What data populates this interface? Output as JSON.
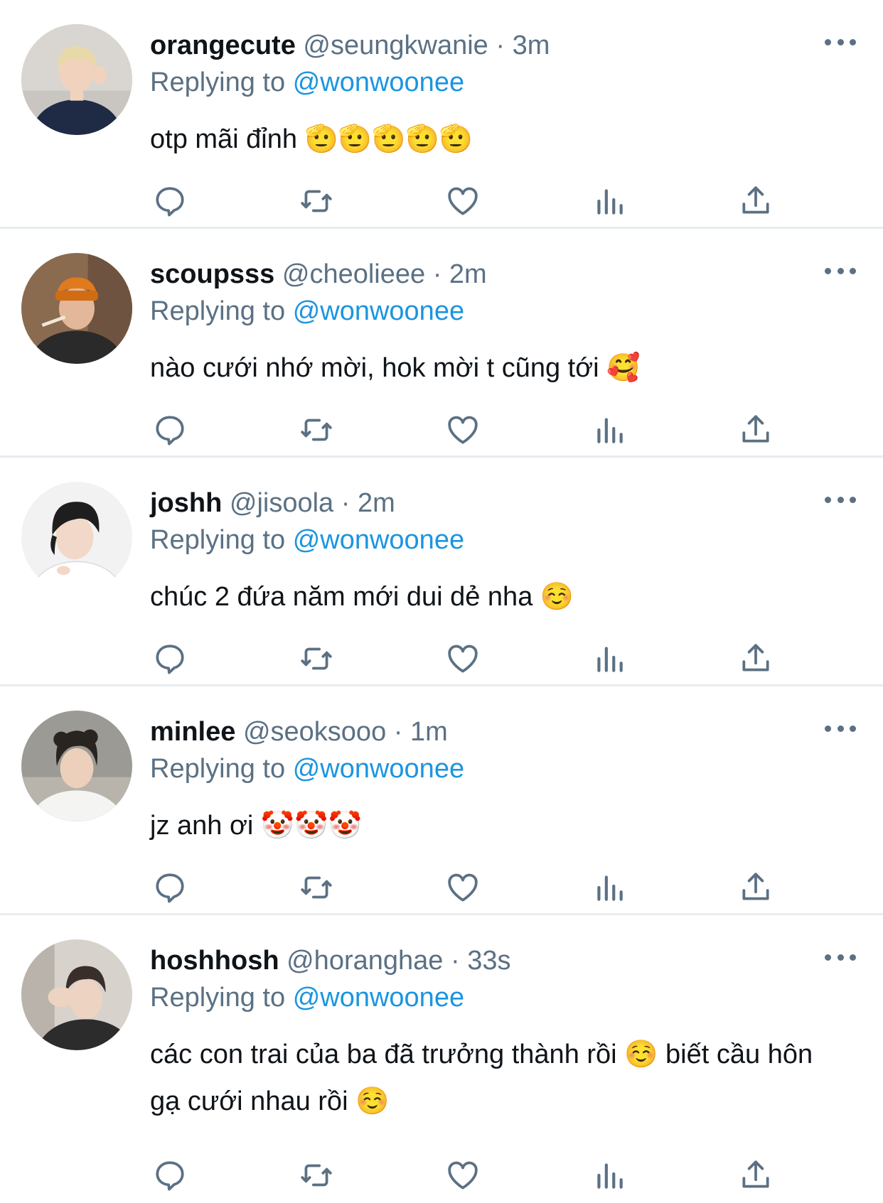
{
  "tweets": [
    {
      "name": "orangecute",
      "handle": "@seungkwanie",
      "separator": "·",
      "time": "3m",
      "replying_prefix": "Replying to",
      "replying_to": "@wonwoonee",
      "text": "otp mãi đỉnh 🫡🫡🫡🫡🫡",
      "avatar_colors": {
        "bg": "#c9c6c2",
        "hair": "#e8d9a8",
        "skin": "#f0d2bd",
        "shirt": "#1f2a44"
      }
    },
    {
      "name": "scoupsss",
      "handle": "@cheolieee",
      "separator": "·",
      "time": "2m",
      "replying_prefix": "Replying to",
      "replying_to": "@wonwoonee",
      "text": "nào cưới nhớ mời, hok mời t cũng tới 🥰",
      "avatar_colors": {
        "bg": "#8a6b4f",
        "hair": "#e07a1f",
        "skin": "#e3b89a",
        "shirt": "#2a2a2a"
      }
    },
    {
      "name": "joshh",
      "handle": "@jisoola",
      "separator": "·",
      "time": "2m",
      "replying_prefix": "Replying to",
      "replying_to": "@wonwoonee",
      "text": "chúc 2 đứa năm mới dui dẻ nha ☺️",
      "avatar_colors": {
        "bg": "#f2f2f2",
        "hair": "#1e1e1e",
        "skin": "#f2d8c8",
        "shirt": "#ffffff"
      }
    },
    {
      "name": "minlee",
      "handle": "@seoksooo",
      "separator": "·",
      "time": "1m",
      "replying_prefix": "Replying to",
      "replying_to": "@wonwoonee",
      "text": "jz anh ơi 🤡🤡🤡",
      "avatar_colors": {
        "bg": "#9c9a94",
        "hair": "#2a2420",
        "skin": "#ecd0bb",
        "shirt": "#f4f4f2"
      }
    },
    {
      "name": "hoshhosh",
      "handle": "@horanghae",
      "separator": "·",
      "time": "33s",
      "replying_prefix": "Replying to",
      "replying_to": "@wonwoonee",
      "text": "các con trai của ba đã trưởng thành rồi ☺️  biết cầu hôn gạ cưới nhau rồi ☺️",
      "avatar_colors": {
        "bg": "#d7d2cc",
        "hair": "#3a2e2a",
        "skin": "#edd3c2",
        "shirt": "#2c2c2c"
      }
    }
  ],
  "icons": {
    "reply": "reply-icon",
    "retweet": "retweet-icon",
    "like": "heart-icon",
    "analytics": "analytics-icon",
    "share": "share-icon",
    "more": "more-icon"
  },
  "colors": {
    "text": "#0f1419",
    "muted": "#5b7083",
    "link": "#1b95e0",
    "divider": "#e6ecf0",
    "icon": "#5b7083"
  }
}
